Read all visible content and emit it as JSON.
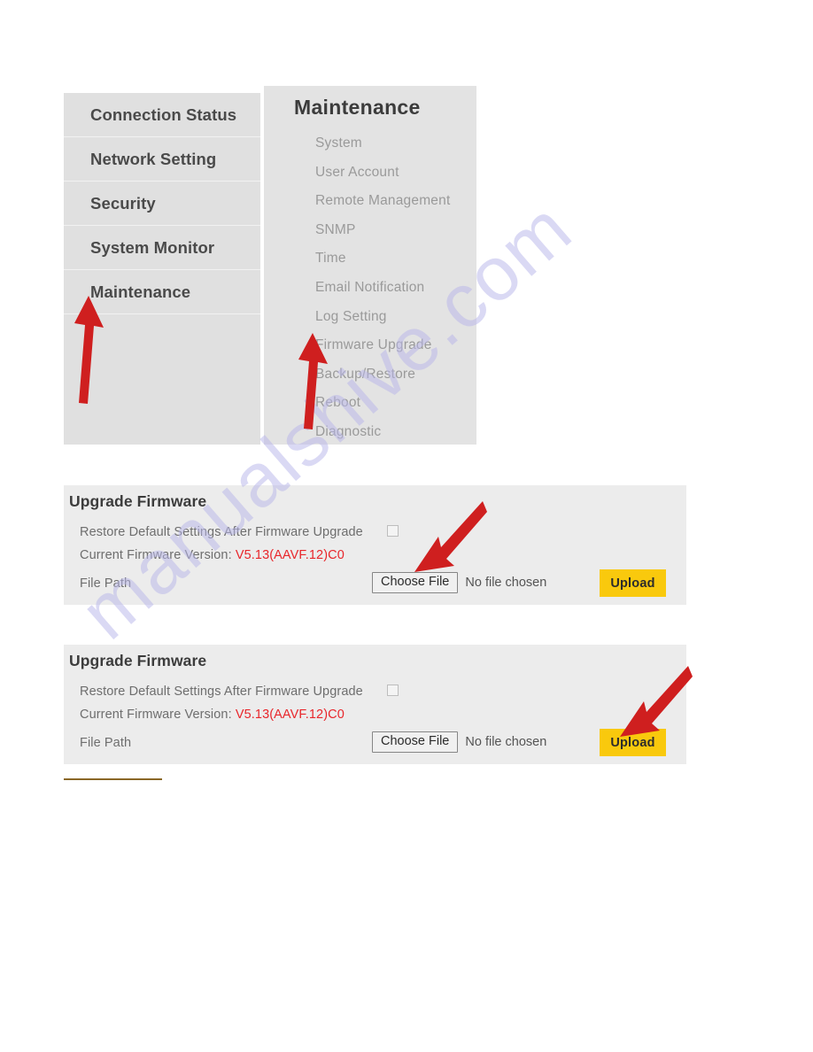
{
  "nav_left": {
    "items": [
      {
        "label": "Connection Status"
      },
      {
        "label": "Network Setting"
      },
      {
        "label": "Security"
      },
      {
        "label": "System Monitor"
      },
      {
        "label": "Maintenance"
      }
    ]
  },
  "nav_right": {
    "title": "Maintenance",
    "items": [
      {
        "label": "System"
      },
      {
        "label": "User Account"
      },
      {
        "label": "Remote Management"
      },
      {
        "label": "SNMP"
      },
      {
        "label": "Time"
      },
      {
        "label": "Email Notification"
      },
      {
        "label": "Log Setting"
      },
      {
        "label": "Firmware Upgrade"
      },
      {
        "label": "Backup/Restore"
      },
      {
        "label": "Reboot"
      },
      {
        "label": "Diagnostic"
      }
    ]
  },
  "firmware_panel": {
    "title": "Upgrade Firmware",
    "restore_label": "Restore Default Settings After Firmware Upgrade",
    "version_label": "Current Firmware Version:",
    "version_value": "V5.13(AAVF.12)C0",
    "file_path_label": "File Path",
    "choose_file_label": "Choose File",
    "no_file_label": "No file chosen",
    "upload_label": "Upload"
  },
  "watermark": {
    "text": "manualshive.com"
  },
  "colors": {
    "accent_yellow": "#f9c90d",
    "arrow_red": "#d61f1f",
    "version_red": "#e8262b",
    "panel_gray": "#ececec",
    "nav_gray": "#e0e0e0"
  }
}
